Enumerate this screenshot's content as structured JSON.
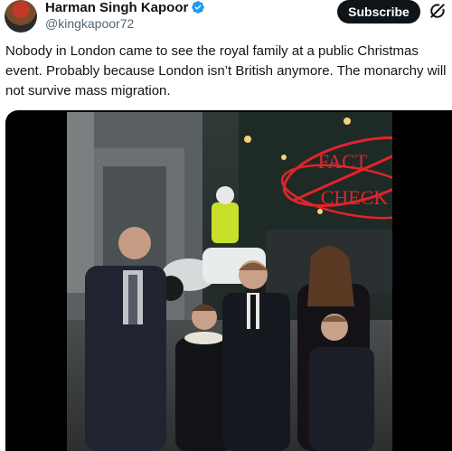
{
  "author": {
    "name": "Harman Singh Kapoor",
    "handle": "@kingkapoor72",
    "verified": true
  },
  "actions": {
    "subscribe_label": "Subscribe",
    "more_icon": "grok-icon"
  },
  "tweet": {
    "text": "Nobody in London came to see the royal family at a public Christmas event. Probably because London isn’t British anymore. The monarchy will not survive mass migration."
  },
  "media": {
    "overlay_stamp_line1": "FACT",
    "overlay_stamp_line2": "CHECK",
    "stamp_color": "#e0242b"
  },
  "colors": {
    "verified_blue": "#1d9bf0",
    "text_primary": "#0f1419",
    "text_secondary": "#536471"
  }
}
